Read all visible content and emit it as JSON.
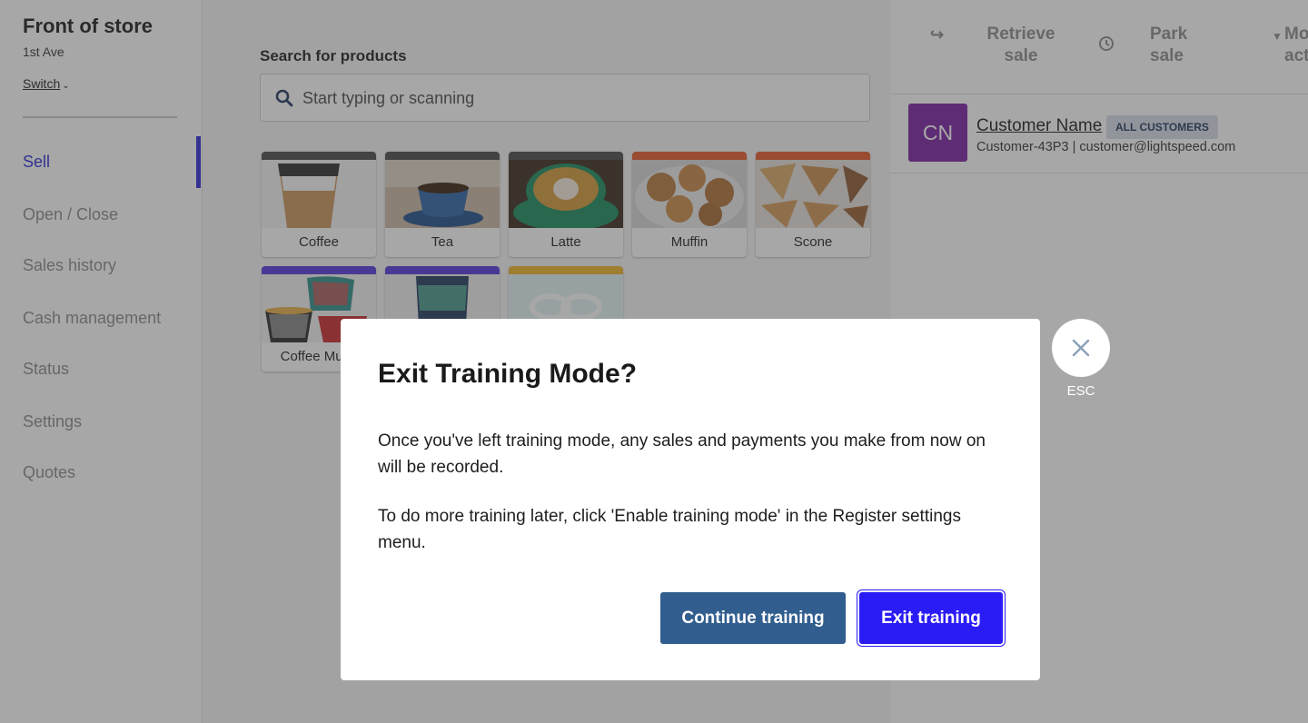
{
  "sidebar": {
    "store_name": "Front of store",
    "location": "1st Ave",
    "switch_label": "Switch",
    "items": [
      {
        "label": "Sell"
      },
      {
        "label": "Open / Close"
      },
      {
        "label": "Sales history"
      },
      {
        "label": "Cash management"
      },
      {
        "label": "Status"
      },
      {
        "label": "Settings"
      },
      {
        "label": "Quotes"
      }
    ],
    "accent_color": "#2b2bd9"
  },
  "search": {
    "label": "Search for products",
    "placeholder": "Start typing or scanning",
    "value": ""
  },
  "products": [
    {
      "label": "Coffee",
      "color": "#4a4a4a",
      "icon": "coffee-cup-image"
    },
    {
      "label": "Tea",
      "color": "#4a4a4a",
      "icon": "tea-cup-image"
    },
    {
      "label": "Latte",
      "color": "#4a4a4a",
      "icon": "latte-image"
    },
    {
      "label": "Muffin",
      "color": "#e55a2b",
      "icon": "muffin-image"
    },
    {
      "label": "Scone",
      "color": "#e55a2b",
      "icon": "scone-image"
    },
    {
      "label": "Coffee Mugs",
      "color": "#5438dc",
      "icon": "mugs-image"
    },
    {
      "label": "",
      "color": "#5438dc",
      "icon": "travel-mug-image"
    },
    {
      "label": "",
      "color": "#f0b429",
      "icon": "gift-card-image"
    }
  ],
  "actions": {
    "retrieve": "Retrieve sale",
    "park": "Park sale",
    "more": "More actions"
  },
  "customer": {
    "initials": "CN",
    "name": "Customer Name",
    "badge": "ALL CUSTOMERS",
    "meta": "Customer-43P3 | customer@lightspeed.com",
    "avatar_color": "#7b1fa2"
  },
  "modal": {
    "title": "Exit Training Mode?",
    "paragraph1": "Once you've left training mode, any sales and payments you make from now on will be recorded.",
    "paragraph2": "To do more training later, click 'Enable training mode' in the Register settings menu.",
    "continue_label": "Continue training",
    "exit_label": "Exit training",
    "esc_label": "ESC"
  }
}
